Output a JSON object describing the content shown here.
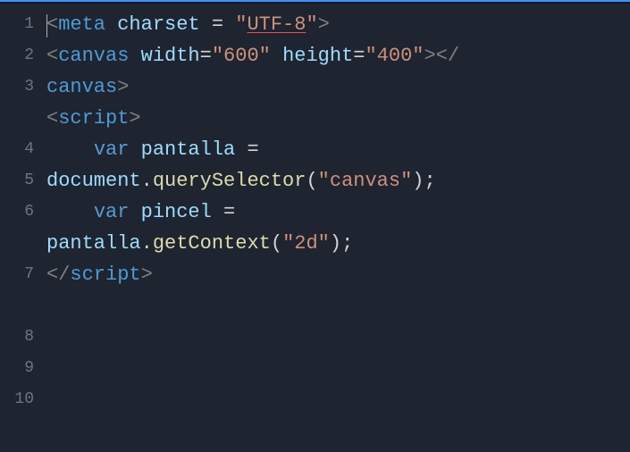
{
  "lines": {
    "l1": "1",
    "l2": "2",
    "l3": "3",
    "l4": "4",
    "l5": "5",
    "l6": "6",
    "l7": "7",
    "l8": "8",
    "l9": "9",
    "l10": "10"
  },
  "code": {
    "meta_open": "<",
    "meta_tag": "meta",
    "meta_sp1": " ",
    "meta_attr": "charset",
    "meta_eq": " = ",
    "meta_q1": "\"",
    "meta_val": "UTF-8",
    "meta_q2": "\"",
    "meta_close": ">",
    "canvas_open": "<",
    "canvas_tag": "canvas",
    "canvas_sp1": " ",
    "canvas_attr1": "width",
    "canvas_eq1": "=",
    "canvas_val1": "\"600\"",
    "canvas_sp2": " ",
    "canvas_attr2": "height",
    "canvas_eq2": "=",
    "canvas_val2": "\"400\"",
    "canvas_close1": ">",
    "canvas_end_open": "</",
    "canvas_wrap": "canvas",
    "canvas_wrap_close": ">",
    "script_open": "<",
    "script_tag": "script",
    "script_close": ">",
    "indent": "    ",
    "var_kw": "var",
    "sp": " ",
    "pantalla": "pantalla",
    "eq": " = ",
    "document": "document",
    "dot": ".",
    "querySelector": "querySelector",
    "paren_open": "(",
    "canvas_str": "\"canvas\"",
    "paren_close": ")",
    "semi": ";",
    "pincel": "pincel",
    "pantalla2": "pantalla",
    "getContext": "getContext",
    "two_d": "\"2d\"",
    "script_end_open": "</",
    "script_end_tag": "script",
    "script_end_close": ">"
  }
}
